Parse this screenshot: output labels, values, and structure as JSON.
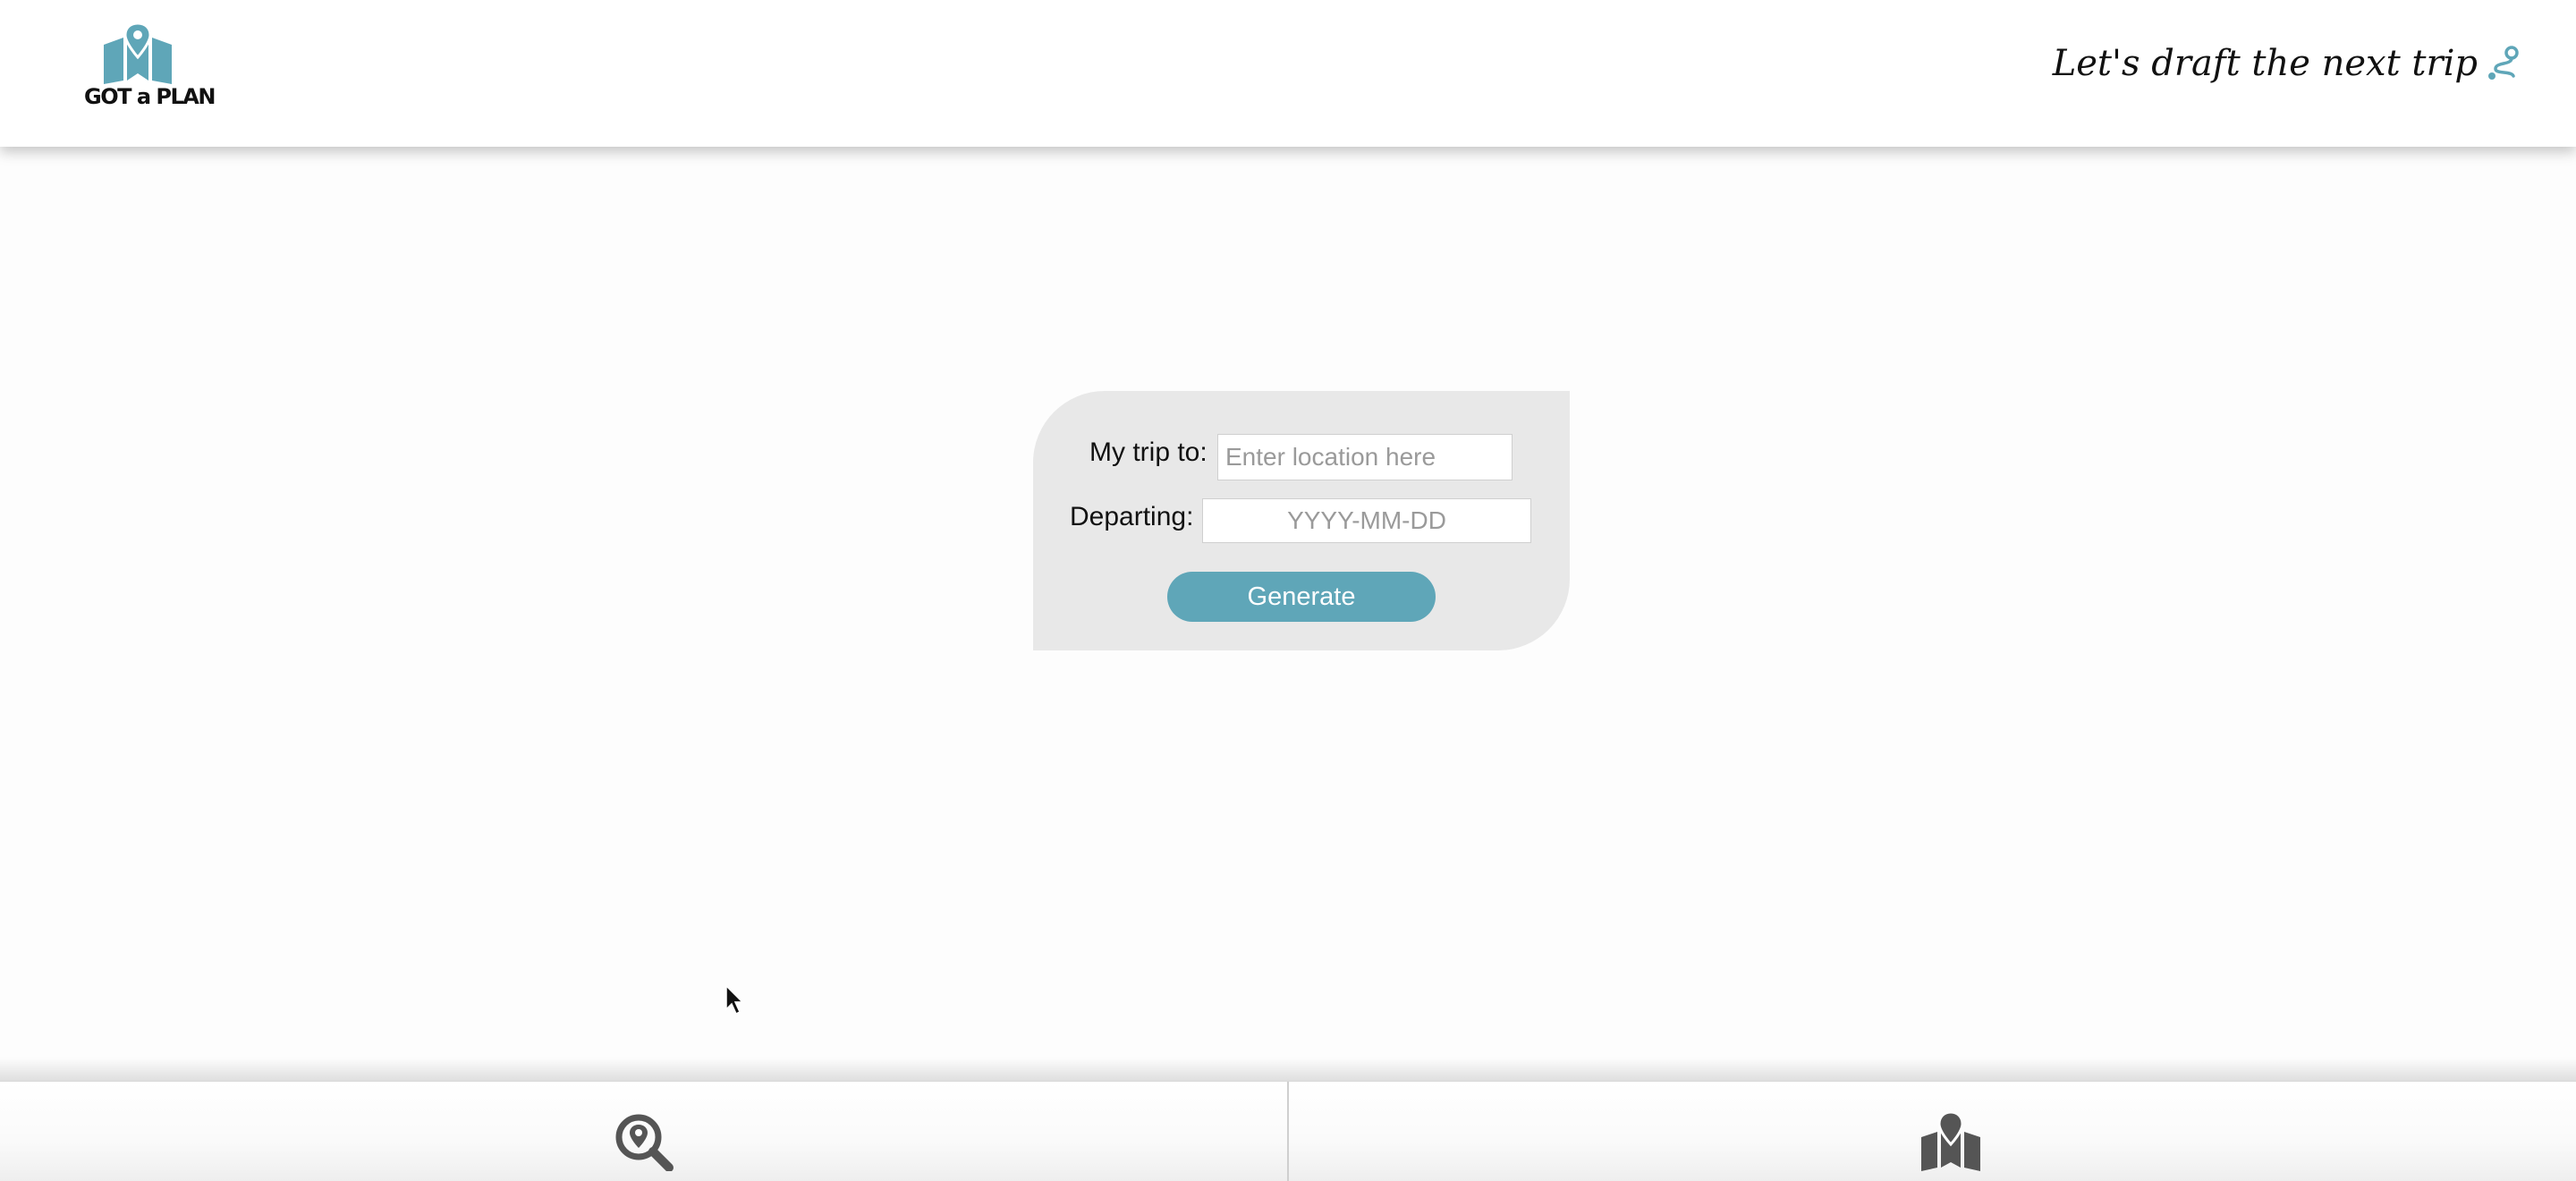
{
  "header": {
    "logo_text": "GOT a PLAN",
    "tagline": "Let's draft the next trip",
    "tagline_icon": "route-icon"
  },
  "form": {
    "destination_label": "My trip to:",
    "destination_placeholder": "Enter location here",
    "destination_value": "",
    "departing_label": "Departing:",
    "departing_placeholder": "YYYY-MM-DD",
    "departing_value": "",
    "generate_label": "Generate"
  },
  "bottom_nav": {
    "tabs": [
      {
        "icon": "search-location-icon"
      },
      {
        "icon": "map-location-icon"
      }
    ]
  },
  "colors": {
    "accent": "#5fa6b8",
    "card_background": "#e8e8e8",
    "icon_dark": "#555555"
  }
}
